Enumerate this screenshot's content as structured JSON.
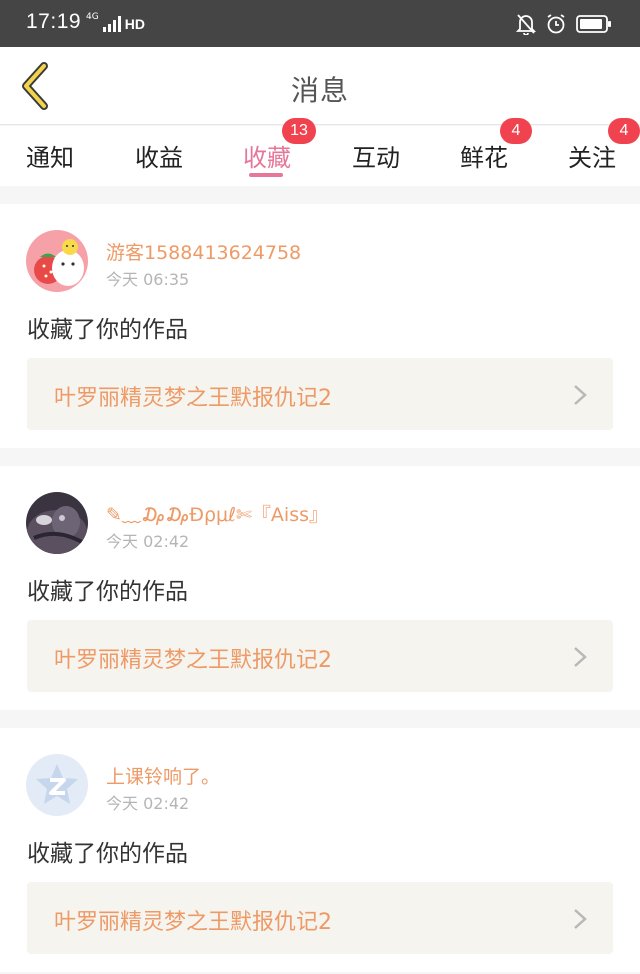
{
  "status_bar": {
    "time": "17:19",
    "network": "4G",
    "hd": "HD"
  },
  "header": {
    "title": "消息",
    "icons": {
      "back": "back-chevron-icon"
    }
  },
  "tabs": [
    {
      "label": "通知",
      "badge": ""
    },
    {
      "label": "收益",
      "badge": ""
    },
    {
      "label": "收藏",
      "badge": "13",
      "active": true
    },
    {
      "label": "互动",
      "badge": ""
    },
    {
      "label": "鲜花",
      "badge": "4"
    },
    {
      "label": "关注",
      "badge": "4"
    }
  ],
  "colors": {
    "accent_pink": "#e6779b",
    "badge_red": "#f0434f",
    "username_orange": "#ee9a66"
  },
  "notifications": [
    {
      "username": "游客1588413624758",
      "time": "今天 06:35",
      "action": "收藏了你的作品",
      "work_title": "叶罗丽精灵梦之王默报仇记2"
    },
    {
      "username": "✎﹏₯₯Ɖρμℓ✄『Aiss』",
      "time": "今天 02:42",
      "action": "收藏了你的作品",
      "work_title": "叶罗丽精灵梦之王默报仇记2"
    },
    {
      "username": "上课铃响了。",
      "time": "今天 02:42",
      "action": "收藏了你的作品",
      "work_title": "叶罗丽精灵梦之王默报仇记2"
    }
  ]
}
